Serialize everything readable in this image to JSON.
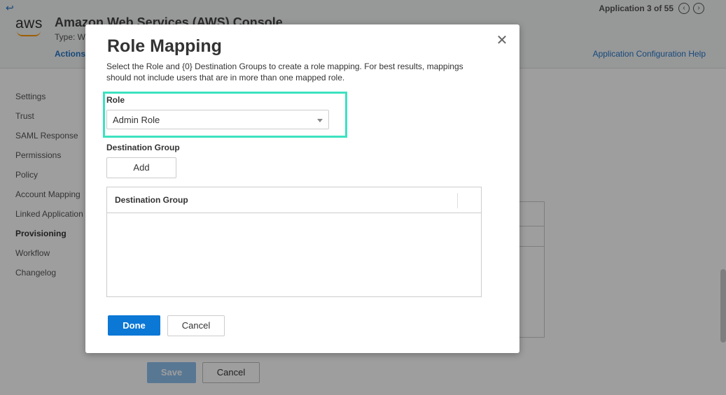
{
  "background": {
    "app_counter": "Application 3 of 55",
    "logo_text": "aws",
    "app_title": "Amazon Web Services (AWS) Console",
    "app_type": "Type: W",
    "actions_label": "Actions",
    "help_link": "Application Configuration Help",
    "sidebar": {
      "items": [
        {
          "label": "Settings"
        },
        {
          "label": "Trust"
        },
        {
          "label": "SAML Response"
        },
        {
          "label": "Permissions"
        },
        {
          "label": "Policy"
        },
        {
          "label": "Account Mapping"
        },
        {
          "label": "Linked Application"
        },
        {
          "label": "Provisioning"
        },
        {
          "label": "Workflow"
        },
        {
          "label": "Changelog"
        }
      ]
    },
    "save_label": "Save",
    "cancel_label": "Cancel"
  },
  "modal": {
    "title": "Role Mapping",
    "description": "Select the Role and {0} Destination Groups to create a role mapping. For best results, mappings should not include users that are in more than one mapped role.",
    "role": {
      "label": "Role",
      "selected": "Admin Role"
    },
    "destination_group": {
      "label": "Destination Group",
      "add_label": "Add",
      "table_header": "Destination Group",
      "rows": []
    },
    "done_label": "Done",
    "cancel_label": "Cancel"
  },
  "colors": {
    "highlight": "#3de2c0",
    "primary": "#0b78d6",
    "link": "#2577c9"
  }
}
